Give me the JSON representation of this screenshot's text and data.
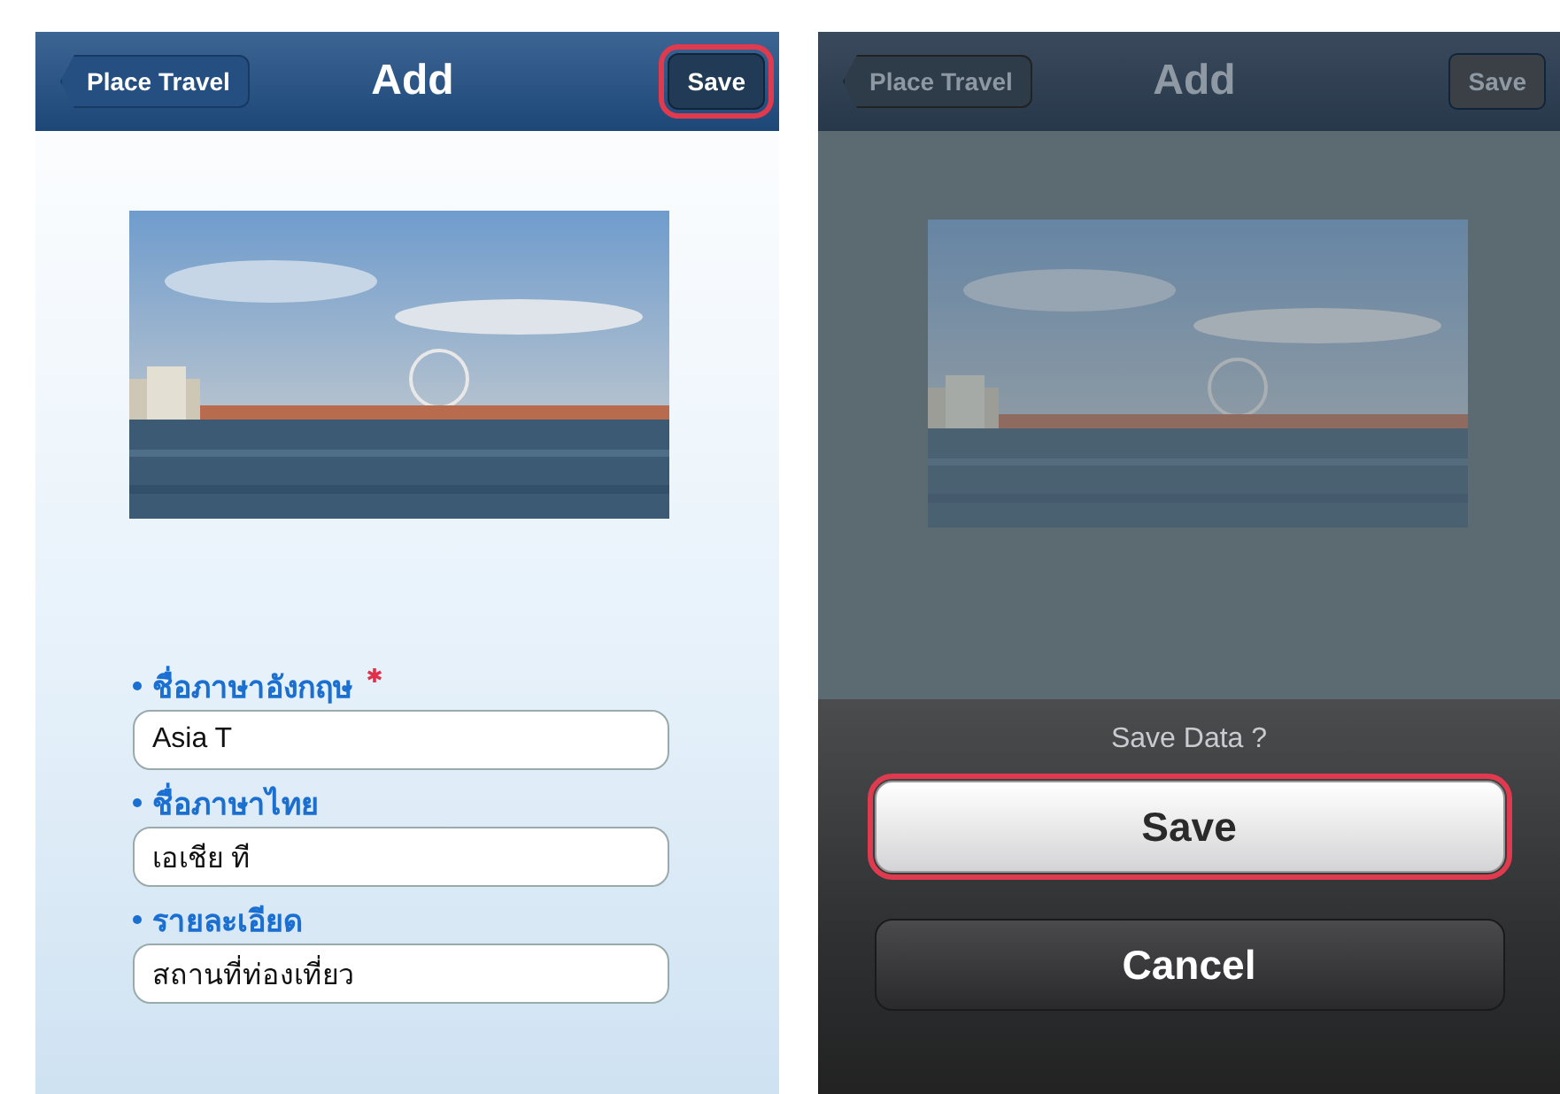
{
  "screens": [
    {
      "kind": "form",
      "nav": {
        "back": "Place Travel",
        "title": "Add",
        "action": "Save",
        "action_highlighted": true
      },
      "fields": [
        {
          "label": "ชื่อภาษาอังกฤษ",
          "required": true,
          "value": "Asia T"
        },
        {
          "label": "ชื่อภาษาไทย",
          "required": false,
          "value": "เอเชีย ที"
        },
        {
          "label": "รายละเอียด",
          "required": false,
          "value": "สถานที่ท่องเที่ยว"
        }
      ]
    },
    {
      "kind": "dialog",
      "nav": {
        "back": "Place Travel",
        "title": "Add",
        "action": "Save",
        "action_highlighted": false
      },
      "sheet": {
        "title": "Save Data ?",
        "buttons": [
          {
            "label": "Save",
            "kind": "default",
            "highlighted": true
          },
          {
            "label": "Cancel",
            "kind": "cancel",
            "highlighted": false
          }
        ]
      }
    }
  ]
}
